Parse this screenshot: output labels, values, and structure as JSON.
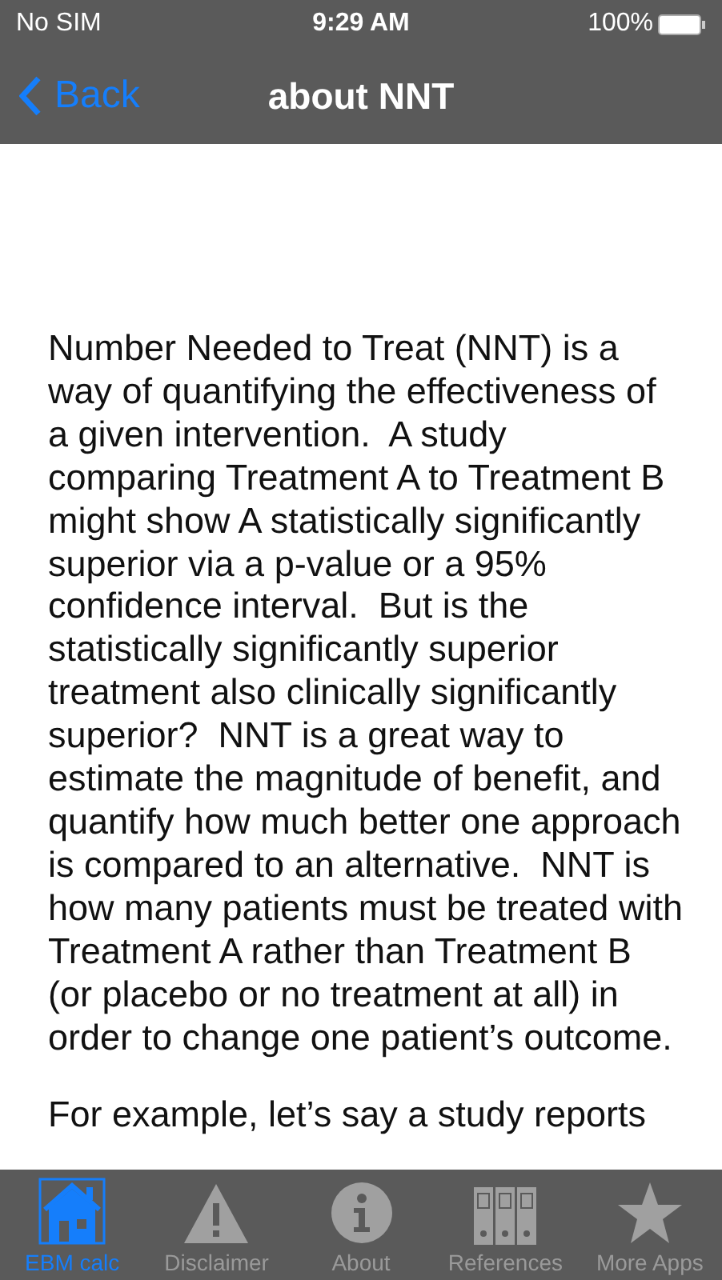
{
  "status_bar": {
    "carrier": "No SIM",
    "time": "9:29 AM",
    "battery": "100%"
  },
  "nav_bar": {
    "back": "Back",
    "title": "about NNT"
  },
  "paragraphs": [
    "Number Needed to Treat (NNT) is a way of quantifying the effectiveness of a given intervention.  A study comparing Treatment A to Treatment B might show A statistically significantly superior via a p-value or a 95% confidence interval.  But is the statistically significantly superior treatment also clinically significantly superior?  NNT is a great way to estimate the magnitude of benefit, and quantify how much better one approach is compared to an alternative.  NNT is how many patients must be treated with Treatment A rather than Treatment B (or placebo or no treatment at all) in order to change one patient’s outcome.",
    "For example, let’s say a study reports"
  ],
  "tabs": [
    {
      "label": "EBM calc",
      "kind": "house",
      "selected": true
    },
    {
      "label": "Disclaimer",
      "kind": "warning",
      "selected": false
    },
    {
      "label": "About",
      "kind": "info",
      "selected": false
    },
    {
      "label": "References",
      "kind": "binders",
      "selected": false
    },
    {
      "label": "More Apps",
      "kind": "star",
      "selected": false
    }
  ]
}
